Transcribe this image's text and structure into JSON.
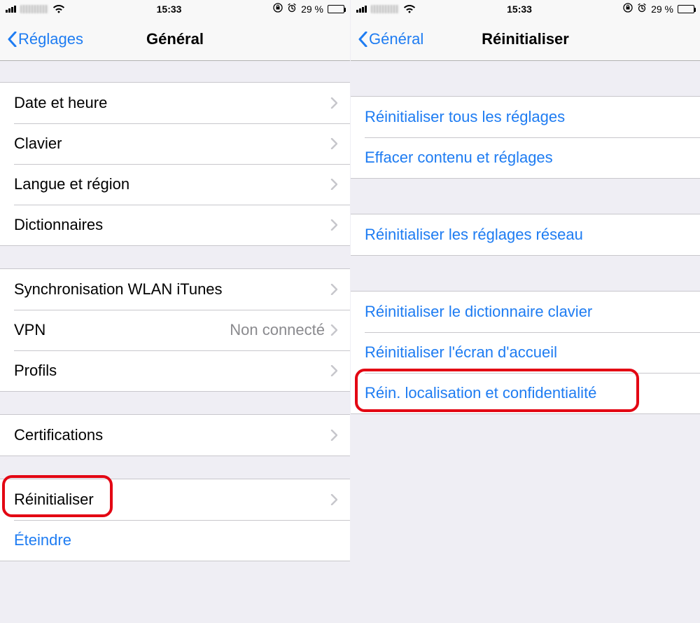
{
  "status": {
    "time": "15:33",
    "battery_text": "29 %"
  },
  "left": {
    "back_label": "Réglages",
    "title": "Général",
    "groups": [
      [
        {
          "label": "Date et heure"
        },
        {
          "label": "Clavier"
        },
        {
          "label": "Langue et région"
        },
        {
          "label": "Dictionnaires"
        }
      ],
      [
        {
          "label": "Synchronisation WLAN iTunes"
        },
        {
          "label": "VPN",
          "value": "Non connecté"
        },
        {
          "label": "Profils"
        }
      ],
      [
        {
          "label": "Certifications"
        }
      ],
      [
        {
          "label": "Réinitialiser"
        },
        {
          "label": "Éteindre",
          "link": true,
          "no_disc": true
        }
      ]
    ]
  },
  "right": {
    "back_label": "Général",
    "title": "Réinitialiser",
    "groups": [
      [
        {
          "label": "Réinitialiser tous les réglages"
        },
        {
          "label": "Effacer contenu et réglages"
        }
      ],
      [
        {
          "label": "Réinitialiser les réglages réseau"
        }
      ],
      [
        {
          "label": "Réinitialiser le dictionnaire clavier"
        },
        {
          "label": "Réinitialiser l'écran d'accueil"
        },
        {
          "label": "Réin. localisation et confidentialité"
        }
      ]
    ]
  }
}
